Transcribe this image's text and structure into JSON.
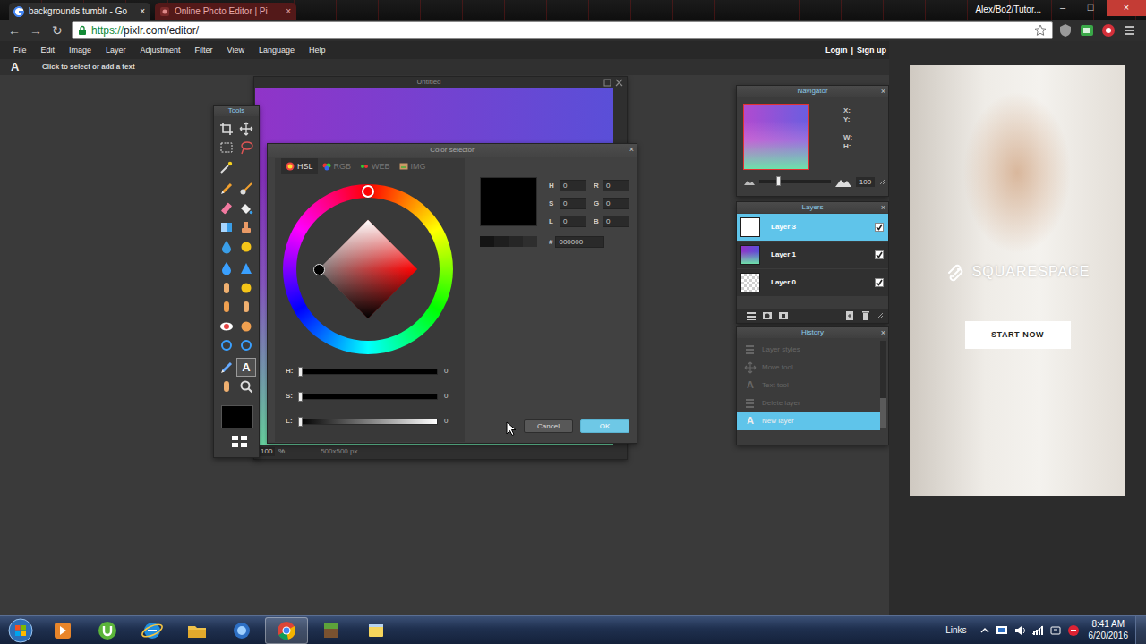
{
  "browser": {
    "tabs": [
      {
        "label": "backgrounds tumblr - Go",
        "close": "×",
        "selected": false
      },
      {
        "label": "Online Photo Editor | Pi",
        "close": "×",
        "selected": true
      }
    ],
    "profile": "Alex/Bo2/Tutor...",
    "window_controls": [
      "–",
      "□",
      "×"
    ],
    "nav": [
      "←",
      "→",
      "↻"
    ],
    "url_scheme": "https://",
    "url_rest": "pixlr.com/editor/"
  },
  "menu": [
    "File",
    "Edit",
    "Image",
    "Layer",
    "Adjustment",
    "Filter",
    "View",
    "Language",
    "Help"
  ],
  "account": {
    "login": "Login",
    "separator": "|",
    "signup": "Sign up"
  },
  "options_bar": {
    "icon": "A",
    "hint": "Click to select or add a text"
  },
  "canvas": {
    "title": "Untitled",
    "zoom": "100",
    "zoom_unit": "%",
    "size": "500x500 px"
  },
  "tools": {
    "title": "Tools",
    "items": [
      {
        "selected": false
      },
      {
        "selected": false
      },
      {
        "selected": false
      },
      {
        "selected": false
      },
      {
        "selected": false
      },
      {
        "selected": false
      },
      {
        "selected": false
      },
      {
        "selected": false
      },
      {
        "selected": false
      },
      {
        "selected": false
      },
      {
        "selected": false
      },
      {
        "selected": false
      },
      {
        "selected": false
      },
      {
        "selected": false
      },
      {
        "selected": false
      },
      {
        "selected": false
      },
      {
        "selected": false
      },
      {
        "selected": false
      },
      {
        "selected": false
      },
      {
        "selected": false
      },
      {
        "selected": false
      },
      {
        "selected": false
      },
      {
        "selected": false
      },
      {
        "selected": false
      },
      {
        "selected": true,
        "glyph": "A"
      },
      {
        "selected": false
      },
      {
        "selected": false
      }
    ]
  },
  "color_selector": {
    "title": "Color selector",
    "close": "×",
    "tabs": [
      {
        "label": "HSL",
        "selected": true
      },
      {
        "label": "RGB",
        "selected": false
      },
      {
        "label": "WEB",
        "selected": false
      },
      {
        "label": "IMG",
        "selected": false
      }
    ],
    "sliders": [
      {
        "label": "H:",
        "value": "0",
        "level": 0
      },
      {
        "label": "S:",
        "value": "0",
        "level": 0
      },
      {
        "label": "L:",
        "value": "0",
        "level": 0
      }
    ],
    "fields": [
      {
        "label": "H",
        "value": "0"
      },
      {
        "label": "R",
        "value": "0"
      },
      {
        "label": "S",
        "value": "0"
      },
      {
        "label": "G",
        "value": "0"
      },
      {
        "label": "L",
        "value": "0"
      },
      {
        "label": "B",
        "value": "0"
      }
    ],
    "hex_label": "#",
    "hex": "000000",
    "buttons": [
      {
        "label": "Cancel",
        "primary": false
      },
      {
        "label": "OK",
        "primary": true
      }
    ]
  },
  "navigator": {
    "title": "Navigator",
    "close": "×",
    "labels": [
      "X:",
      "Y:",
      "W:",
      "H:"
    ],
    "zoom": "100",
    "zoom_level": 0.27
  },
  "layers": {
    "title": "Layers",
    "close": "×",
    "items": [
      {
        "name": "Layer 3",
        "kind": "blank",
        "visible": true,
        "selected": true
      },
      {
        "name": "Layer 1",
        "kind": "gradient",
        "visible": true,
        "selected": false
      },
      {
        "name": "Layer 0",
        "kind": "transparent",
        "visible": true,
        "selected": false
      }
    ]
  },
  "history": {
    "title": "History",
    "close": "×",
    "items": [
      {
        "label": "Layer styles",
        "dimmed": true,
        "selected": false
      },
      {
        "label": "Move tool",
        "dimmed": true,
        "selected": false
      },
      {
        "label": "Text tool",
        "glyph": "A",
        "dimmed": true,
        "selected": false
      },
      {
        "label": "Delete layer",
        "dimmed": true,
        "selected": false
      },
      {
        "label": "New layer",
        "glyph": "A",
        "dimmed": false,
        "selected": true
      }
    ]
  },
  "ad": {
    "brand": "SQUARESPACE",
    "cta": "START NOW"
  },
  "taskbar": {
    "apps": [
      {
        "active": false
      },
      {
        "active": false
      },
      {
        "active": false
      },
      {
        "active": false
      },
      {
        "active": false
      },
      {
        "active": true
      },
      {
        "active": false
      },
      {
        "active": false
      }
    ],
    "links": "Links",
    "time": "8:41 AM",
    "date": "6/20/2016"
  }
}
